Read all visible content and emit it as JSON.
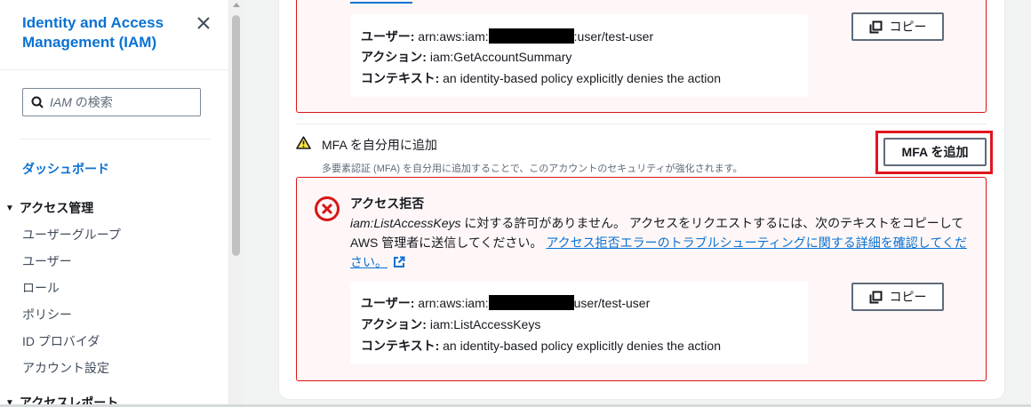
{
  "sidebar": {
    "title": "Identity and Access Management (IAM)",
    "search_placeholder_italic": "IAM",
    "search_placeholder_rest": " の検索",
    "dashboard": "ダッシュボード",
    "section_access_management": "アクセス管理",
    "items": [
      {
        "label": "ユーザーグループ"
      },
      {
        "label": "ユーザー"
      },
      {
        "label": "ロール"
      },
      {
        "label": "ポリシー"
      },
      {
        "label": "ID プロバイダ"
      },
      {
        "label": "アカウント設定"
      }
    ],
    "section_access_reports": "アクセスレポート"
  },
  "alert1": {
    "user_label": "ユーザー:",
    "user_prefix": " arn:aws:iam:",
    "user_suffix": ":user/test-user",
    "action_label": "アクション:",
    "action_value": " iam:GetAccountSummary",
    "context_label": "コンテキスト:",
    "context_value": " an identity-based policy explicitly denies the action",
    "copy_label": "コピー"
  },
  "mfa": {
    "title": "MFA を自分用に追加",
    "description": "多要素認証 (MFA) を自分用に追加することで、このアカウントのセキュリティが強化されます。",
    "button_label": "MFA を追加"
  },
  "alert2": {
    "title": "アクセス拒否",
    "body_italic": "iam:ListAccessKeys",
    "body_text": " に対する許可がありません。 アクセスをリクエストするには、次のテキストをコピーして AWS 管理者に送信してください。 ",
    "link_text": "アクセス拒否エラーのトラブルシューティングに関する詳細を確認してください。",
    "user_label": "ユーザー:",
    "user_prefix": " arn:aws:iam:",
    "user_suffix": "user/test-user",
    "action_label": "アクション:",
    "action_value": " iam:ListAccessKeys",
    "context_label": "コンテキスト:",
    "context_value": " an identity-based policy explicitly denies the action",
    "copy_label": "コピー"
  },
  "icons": {
    "close": "close-icon",
    "search": "search-icon",
    "warning": "warning-icon",
    "error": "error-icon",
    "copy": "copy-icon",
    "external": "external-link-icon"
  },
  "colors": {
    "link": "#0972d3",
    "error": "#d91515",
    "highlight": "#e0161d",
    "warning": "#8d6605"
  }
}
